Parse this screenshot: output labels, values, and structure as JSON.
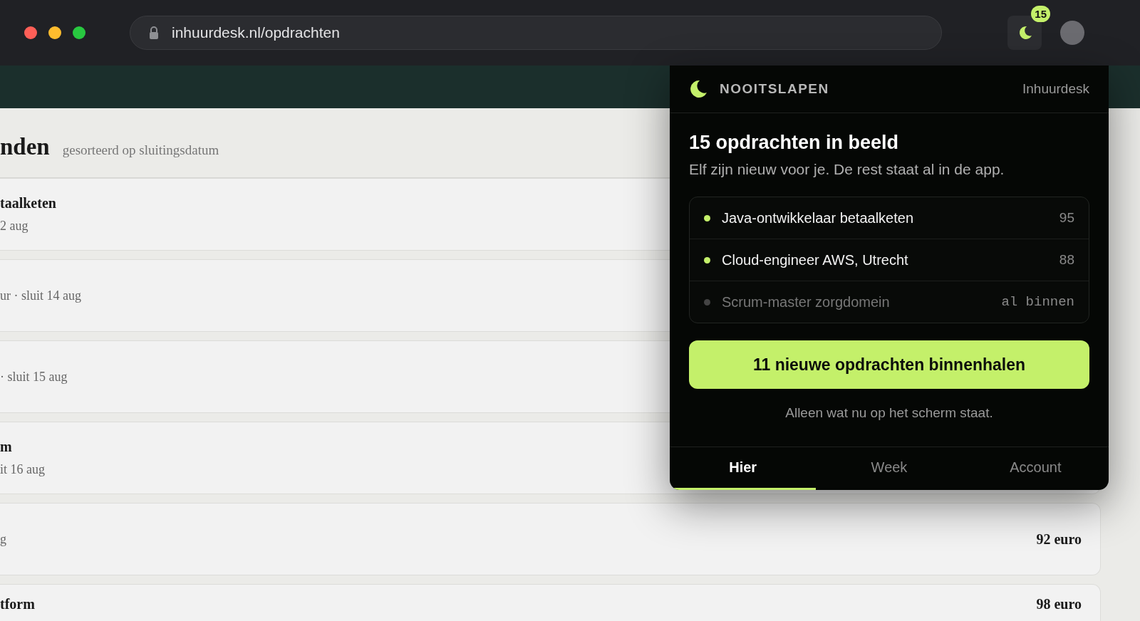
{
  "browser": {
    "url": "inhuurdesk.nl/opdrachten",
    "extension_badge": "15"
  },
  "page": {
    "heading": "nden",
    "subheading": "gesorteerd op sluitingsdatum",
    "rows": [
      {
        "title": "taalketen",
        "meta": "2 aug"
      },
      {
        "meta": "ur · sluit 14 aug"
      },
      {
        "meta": "· sluit 15 aug"
      },
      {
        "title": "m",
        "meta": "it 16 aug"
      },
      {
        "meta": "g",
        "price": "92 euro"
      },
      {
        "title": "tform",
        "price": "98 euro"
      }
    ]
  },
  "popup": {
    "brand": "NOOITSLAPEN",
    "site": "Inhuurdesk",
    "title": "15 opdrachten in beeld",
    "subtitle": "Elf zijn nieuw voor je. De rest staat al in de app.",
    "items": [
      {
        "title": "Java-ontwikkelaar betaalketen",
        "meta": "95",
        "new": true
      },
      {
        "title": "Cloud-engineer AWS, Utrecht",
        "meta": "88",
        "new": true
      },
      {
        "title": "Scrum-master zorgdomein",
        "meta": "al binnen",
        "new": false
      }
    ],
    "button": "11 nieuwe opdrachten binnenhalen",
    "note": "Alleen wat nu op het scherm staat.",
    "tabs": [
      {
        "label": "Hier",
        "selected": true
      },
      {
        "label": "Week",
        "selected": false
      },
      {
        "label": "Account",
        "selected": false
      }
    ]
  }
}
